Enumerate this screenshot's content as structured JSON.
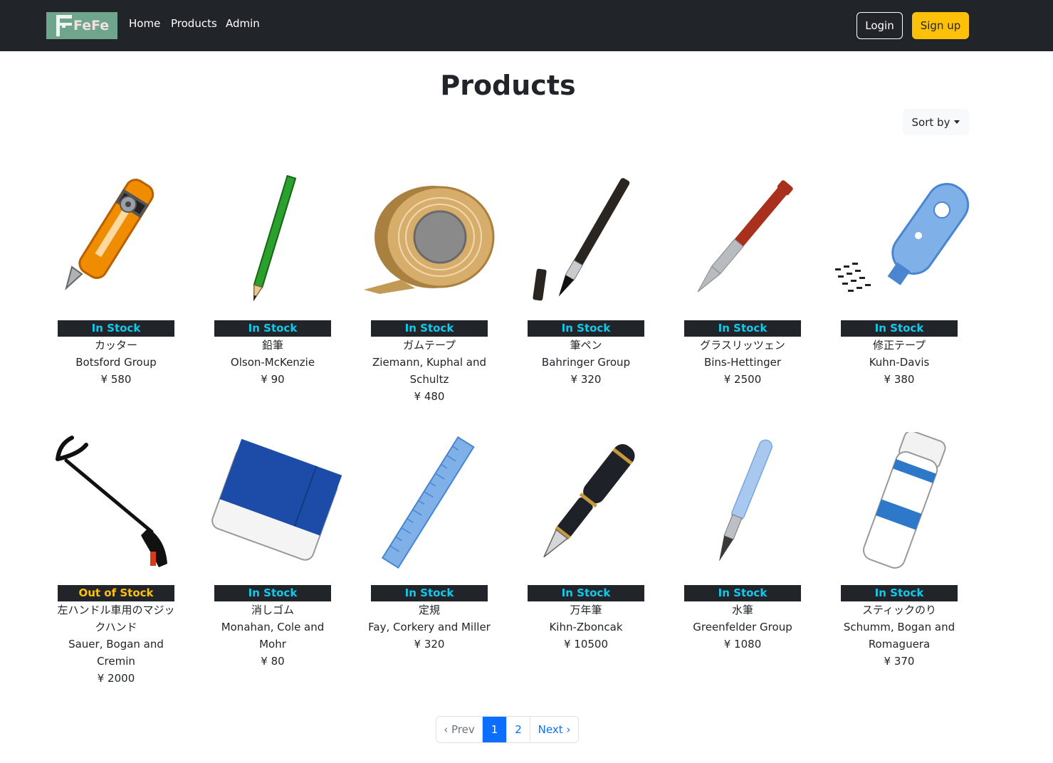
{
  "navbar": {
    "brand": "FeFe",
    "links": [
      "Home",
      "Products",
      "Admin"
    ],
    "login": "Login",
    "signup": "Sign up"
  },
  "page": {
    "title": "Products",
    "sort_label": "Sort by"
  },
  "products": [
    {
      "status": "In Stock",
      "name": "カッター",
      "company": "Botsford Group",
      "price": "¥ 580",
      "icon": "utility-knife"
    },
    {
      "status": "In Stock",
      "name": "鉛筆",
      "company": "Olson-McKenzie",
      "price": "¥ 90",
      "icon": "pencil"
    },
    {
      "status": "In Stock",
      "name": "ガムテープ",
      "company": "Ziemann, Kuphal and Schultz",
      "price": "¥ 480",
      "icon": "packing-tape"
    },
    {
      "status": "In Stock",
      "name": "筆ペン",
      "company": "Bahringer Group",
      "price": "¥ 320",
      "icon": "brush-pen"
    },
    {
      "status": "In Stock",
      "name": "グラスリッツェン",
      "company": "Bins-Hettinger",
      "price": "¥ 2500",
      "icon": "glass-engraving-pen"
    },
    {
      "status": "In Stock",
      "name": "修正テープ",
      "company": "Kuhn-Davis",
      "price": "¥ 380",
      "icon": "correction-tape"
    },
    {
      "status": "Out of Stock",
      "name": "左ハンドル車用のマジックハンド",
      "company": "Sauer, Bogan and Cremin",
      "price": "¥ 2000",
      "icon": "reacher-grabber"
    },
    {
      "status": "In Stock",
      "name": "消しゴム",
      "company": "Monahan, Cole and Mohr",
      "price": "¥ 80",
      "icon": "eraser"
    },
    {
      "status": "In Stock",
      "name": "定規",
      "company": "Fay, Corkery and Miller",
      "price": "¥ 320",
      "icon": "ruler"
    },
    {
      "status": "In Stock",
      "name": "万年筆",
      "company": "Kihn-Zboncak",
      "price": "¥ 10500",
      "icon": "fountain-pen"
    },
    {
      "status": "In Stock",
      "name": "水筆",
      "company": "Greenfelder Group",
      "price": "¥ 1080",
      "icon": "water-brush"
    },
    {
      "status": "In Stock",
      "name": "スティックのり",
      "company": "Schumm, Bogan and Romaguera",
      "price": "¥ 370",
      "icon": "glue-stick"
    }
  ],
  "pagination": {
    "prev": "‹ Prev",
    "pages": [
      "1",
      "2"
    ],
    "current": "1",
    "next": "Next ›"
  },
  "colors": {
    "navbar_bg": "#212529",
    "brand_bg": "#6fa58c",
    "in_stock": "#0dcaf0",
    "out_of_stock": "#ffc107",
    "primary": "#0d6efd"
  }
}
